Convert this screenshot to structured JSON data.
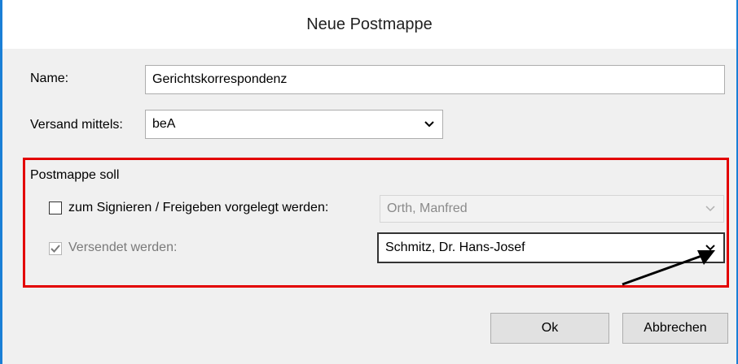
{
  "dialog": {
    "title": "Neue Postmappe",
    "accent_color": "#1a7fd6",
    "highlight_color": "#e30000"
  },
  "form": {
    "name_label": "Name:",
    "name_value": "Gerichtskorrespondenz",
    "versand_label": "Versand mittels:",
    "versand_value": "beA"
  },
  "group": {
    "title": "Postmappe soll",
    "sign_label": "zum Signieren / Freigeben vorgelegt werden:",
    "sign_checked": false,
    "sign_person": "Orth, Manfred",
    "send_label": "Versendet werden:",
    "send_checked": true,
    "send_person": "Schmitz, Dr. Hans-Josef"
  },
  "buttons": {
    "ok_label": "Ok",
    "cancel_label": "Abbrechen"
  },
  "icons": {
    "dropdown": "chevron-down-icon",
    "check": "checkmark-icon",
    "annotation": "arrow-icon"
  }
}
